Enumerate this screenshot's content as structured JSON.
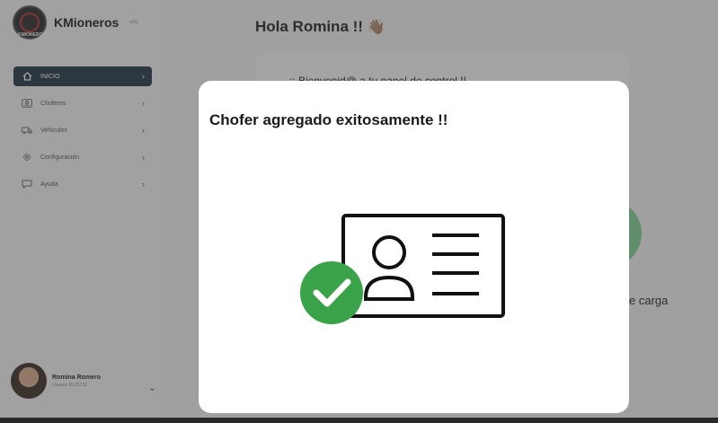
{
  "brand": {
    "name": "KMioneros",
    "version": "v.01",
    "logo_text": "KMIONEROS"
  },
  "sidebar": {
    "items": [
      {
        "label": "INICIO",
        "icon": "home-icon",
        "active": true
      },
      {
        "label": "Choferes",
        "icon": "id-card-icon",
        "active": false
      },
      {
        "label": "Vehiculos",
        "icon": "truck-icon",
        "active": false
      },
      {
        "label": "Configuración",
        "icon": "gear-icon",
        "active": false
      },
      {
        "label": "Ayuda",
        "icon": "chat-help-icon",
        "active": false
      }
    ]
  },
  "user": {
    "name": "Romina Romero",
    "id_label": "Usuario ID 25732"
  },
  "main": {
    "greeting": "Hola Romina !!",
    "greeting_emoji": "👋🏽",
    "panel_text": ":: Bienvenid@ a tu panel de control !!",
    "partial_text": "e carga"
  },
  "modal": {
    "title": "Chofer agregado exitosamente !!",
    "illustration": "driver-id-card-check-icon"
  },
  "colors": {
    "active_nav": "#1f3342",
    "success": "#3aa34a",
    "overlay": "rgba(60,60,60,0.45)"
  }
}
